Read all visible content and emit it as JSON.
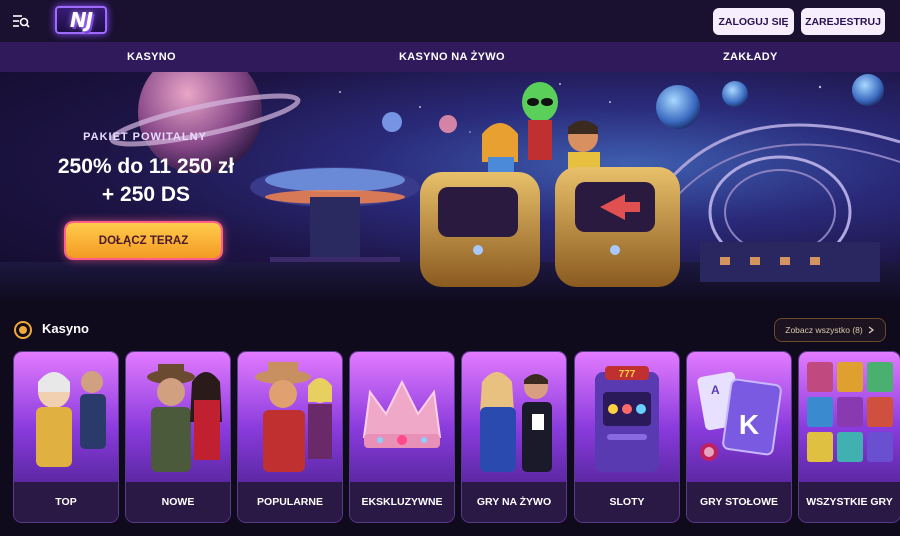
{
  "header": {
    "logo_text": "NJ",
    "login_label": "ZALOGUJ SIĘ",
    "register_label": "ZAREJESTRUJ"
  },
  "nav": {
    "items": [
      "KASYNO",
      "KASYNO NA ŻYWO",
      "ZAKŁADY"
    ]
  },
  "hero": {
    "subtitle": "PAKIET POWITALNY",
    "title_line1": "250% do 11 250 zł",
    "title_line2": "+ 250 DS",
    "cta_label": "DOŁĄCZ TERAZ"
  },
  "casino_section": {
    "title": "Kasyno",
    "see_all_label": "Zobacz wszystko (8)",
    "categories": [
      "TOP",
      "NOWE",
      "POPULARNE",
      "EKSKLUZYWNE",
      "GRY NA ŻYWO",
      "SLOTY",
      "GRY STOŁOWE",
      "WSZYSTKIE GRY"
    ]
  },
  "colors": {
    "header_bg": "#1a1030",
    "nav_bg": "#311a5c",
    "cta_gradient": [
      "#ffcc4d",
      "#f39a22"
    ],
    "accent_pink": "#ff5d8a",
    "card_label_bg": "#2a1845"
  },
  "icons": {
    "menu": "menu-search-icon",
    "section": "casino-chip-icon",
    "see_all": "chevron-right-icon"
  }
}
